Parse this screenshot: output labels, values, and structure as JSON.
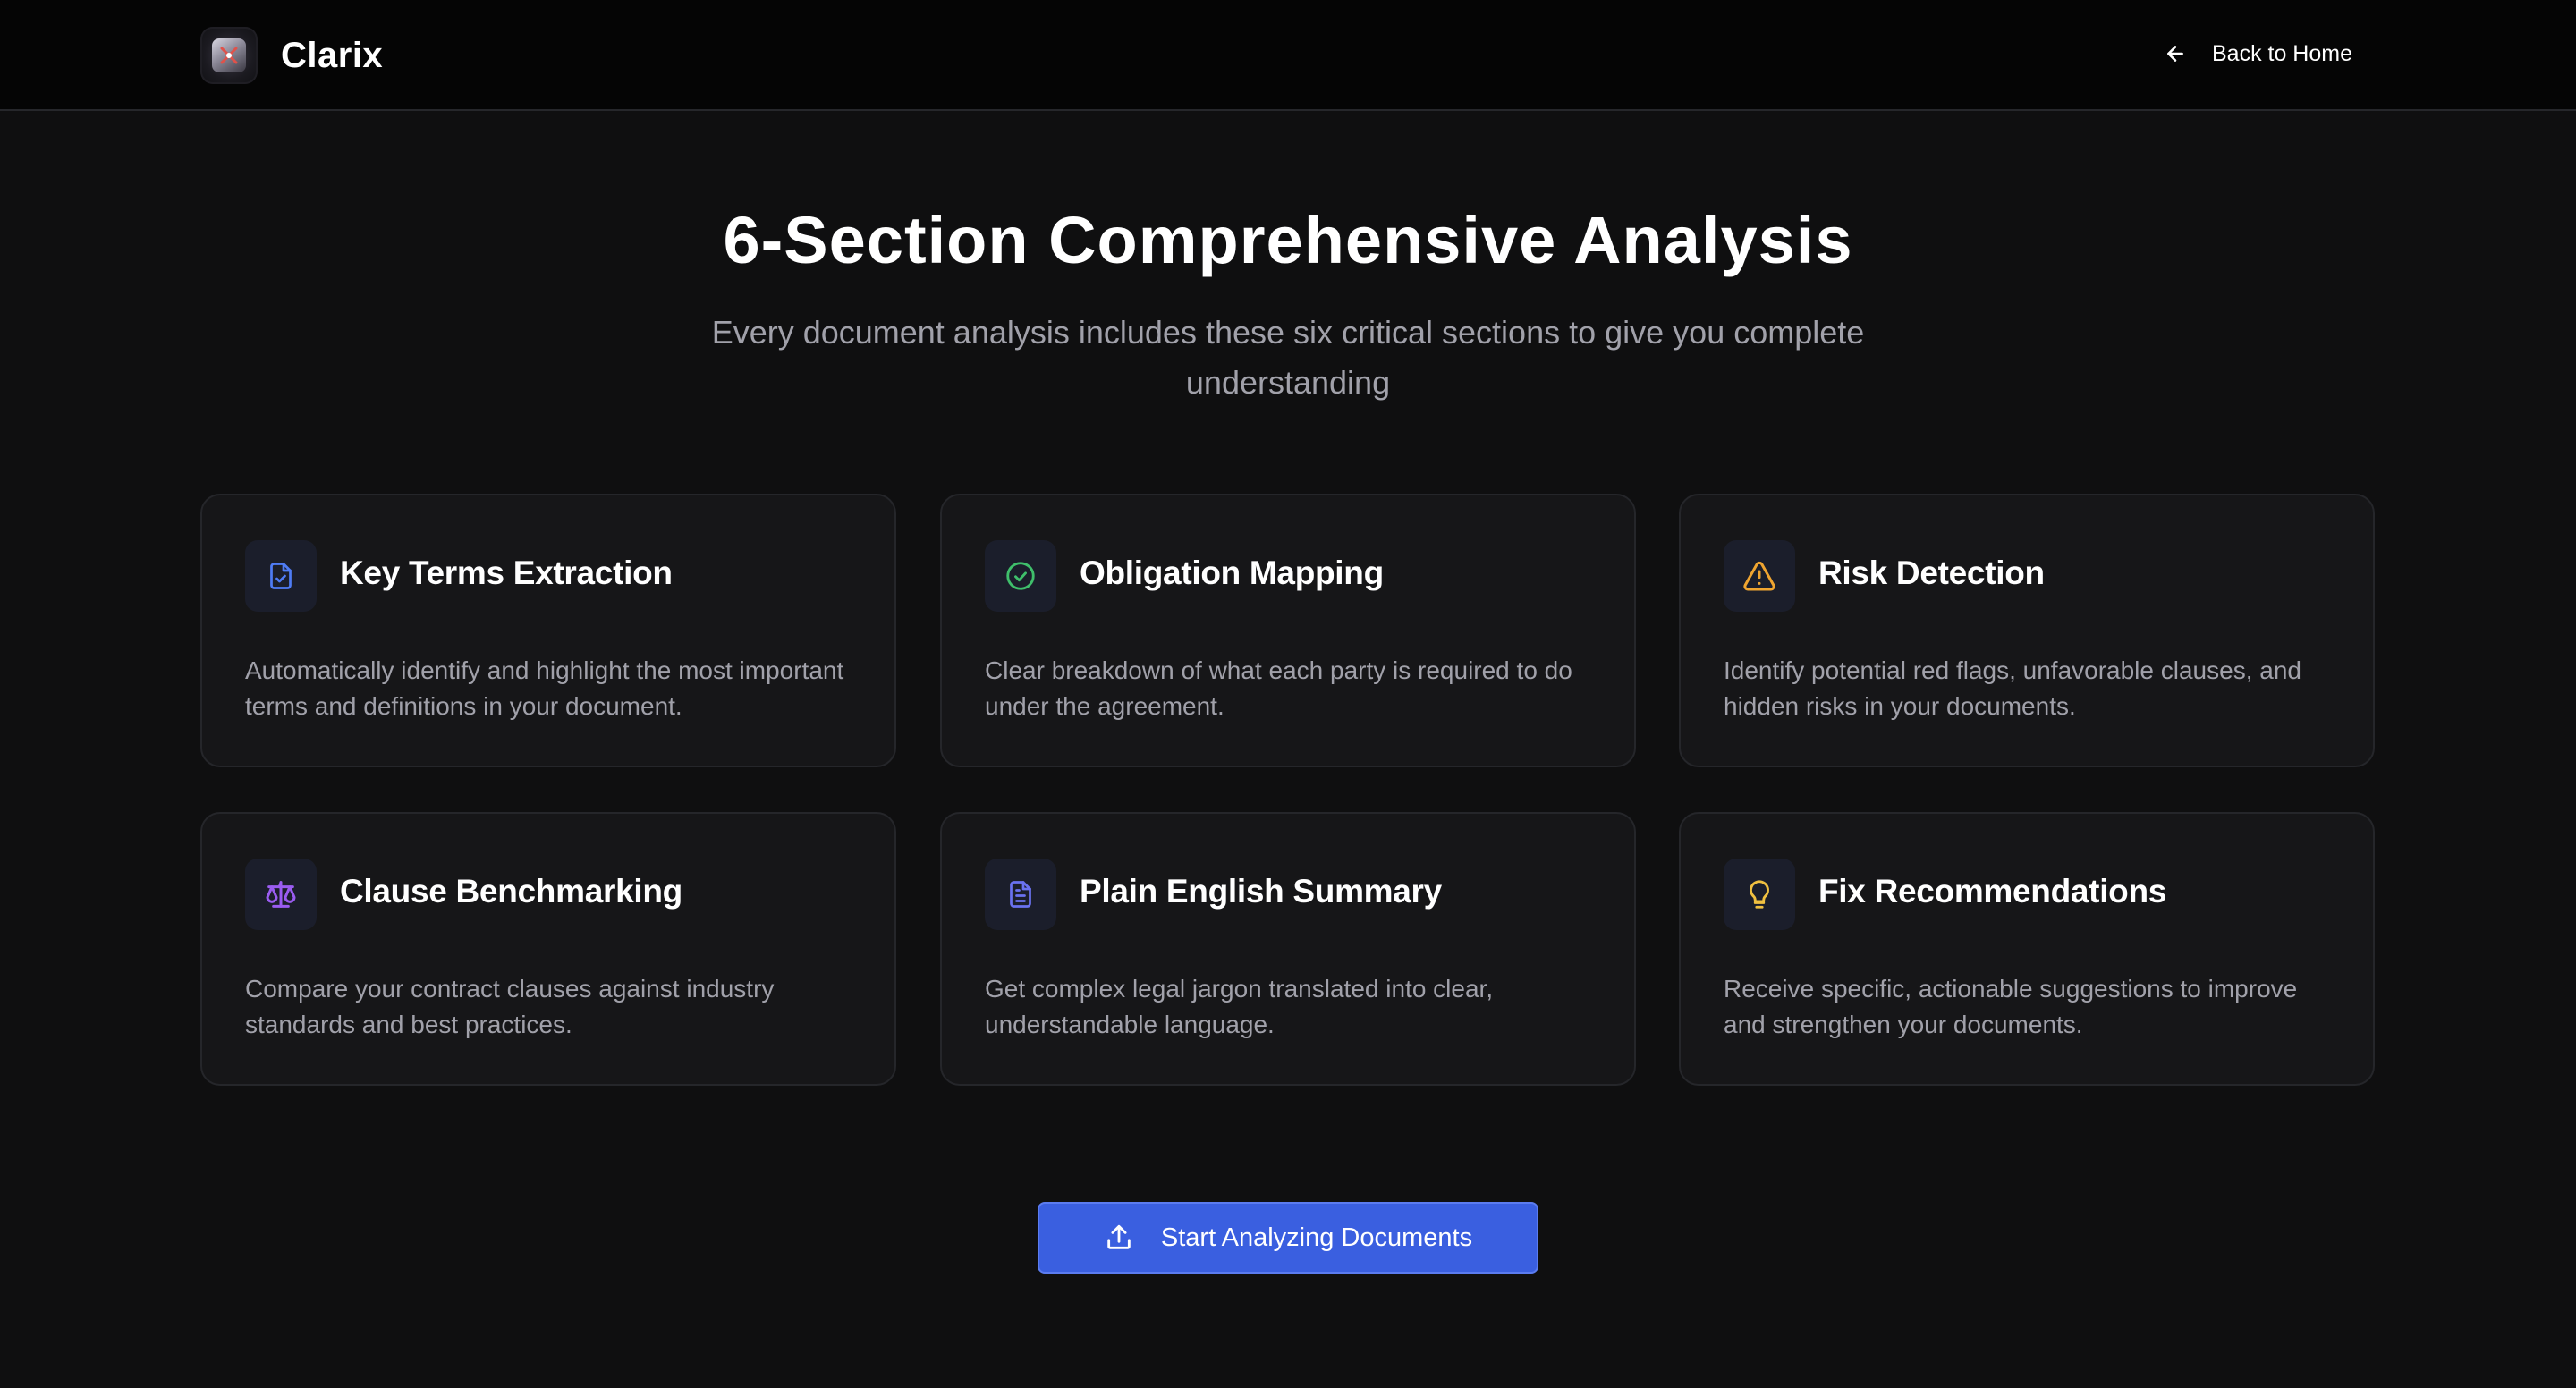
{
  "header": {
    "brand_name": "Clarix",
    "back_label": "Back to Home"
  },
  "hero": {
    "title": "6-Section Comprehensive Analysis",
    "subtitle": "Every document analysis includes these six critical sections to give you complete understanding"
  },
  "cards": [
    {
      "title": "Key Terms Extraction",
      "description": "Automatically identify and highlight the most important terms and definitions in your document.",
      "icon": "file-check-icon",
      "icon_color": "#4f7cf5"
    },
    {
      "title": "Obligation Mapping",
      "description": "Clear breakdown of what each party is required to do under the agreement.",
      "icon": "check-circle-icon",
      "icon_color": "#3fbf6b"
    },
    {
      "title": "Risk Detection",
      "description": "Identify potential red flags, unfavorable clauses, and hidden risks in your documents.",
      "icon": "warning-triangle-icon",
      "icon_color": "#f0a530"
    },
    {
      "title": "Clause Benchmarking",
      "description": "Compare your contract clauses against industry standards and best practices.",
      "icon": "scale-icon",
      "icon_color": "#9a5cf0"
    },
    {
      "title": "Plain English Summary",
      "description": "Get complex legal jargon translated into clear, understandable language.",
      "icon": "document-text-icon",
      "icon_color": "#6a72f0"
    },
    {
      "title": "Fix Recommendations",
      "description": "Receive specific, actionable suggestions to improve and strengthen your documents.",
      "icon": "lightbulb-icon",
      "icon_color": "#f0c040"
    }
  ],
  "cta": {
    "label": "Start Analyzing Documents",
    "icon": "upload-icon",
    "color": "#3a5fe0"
  }
}
